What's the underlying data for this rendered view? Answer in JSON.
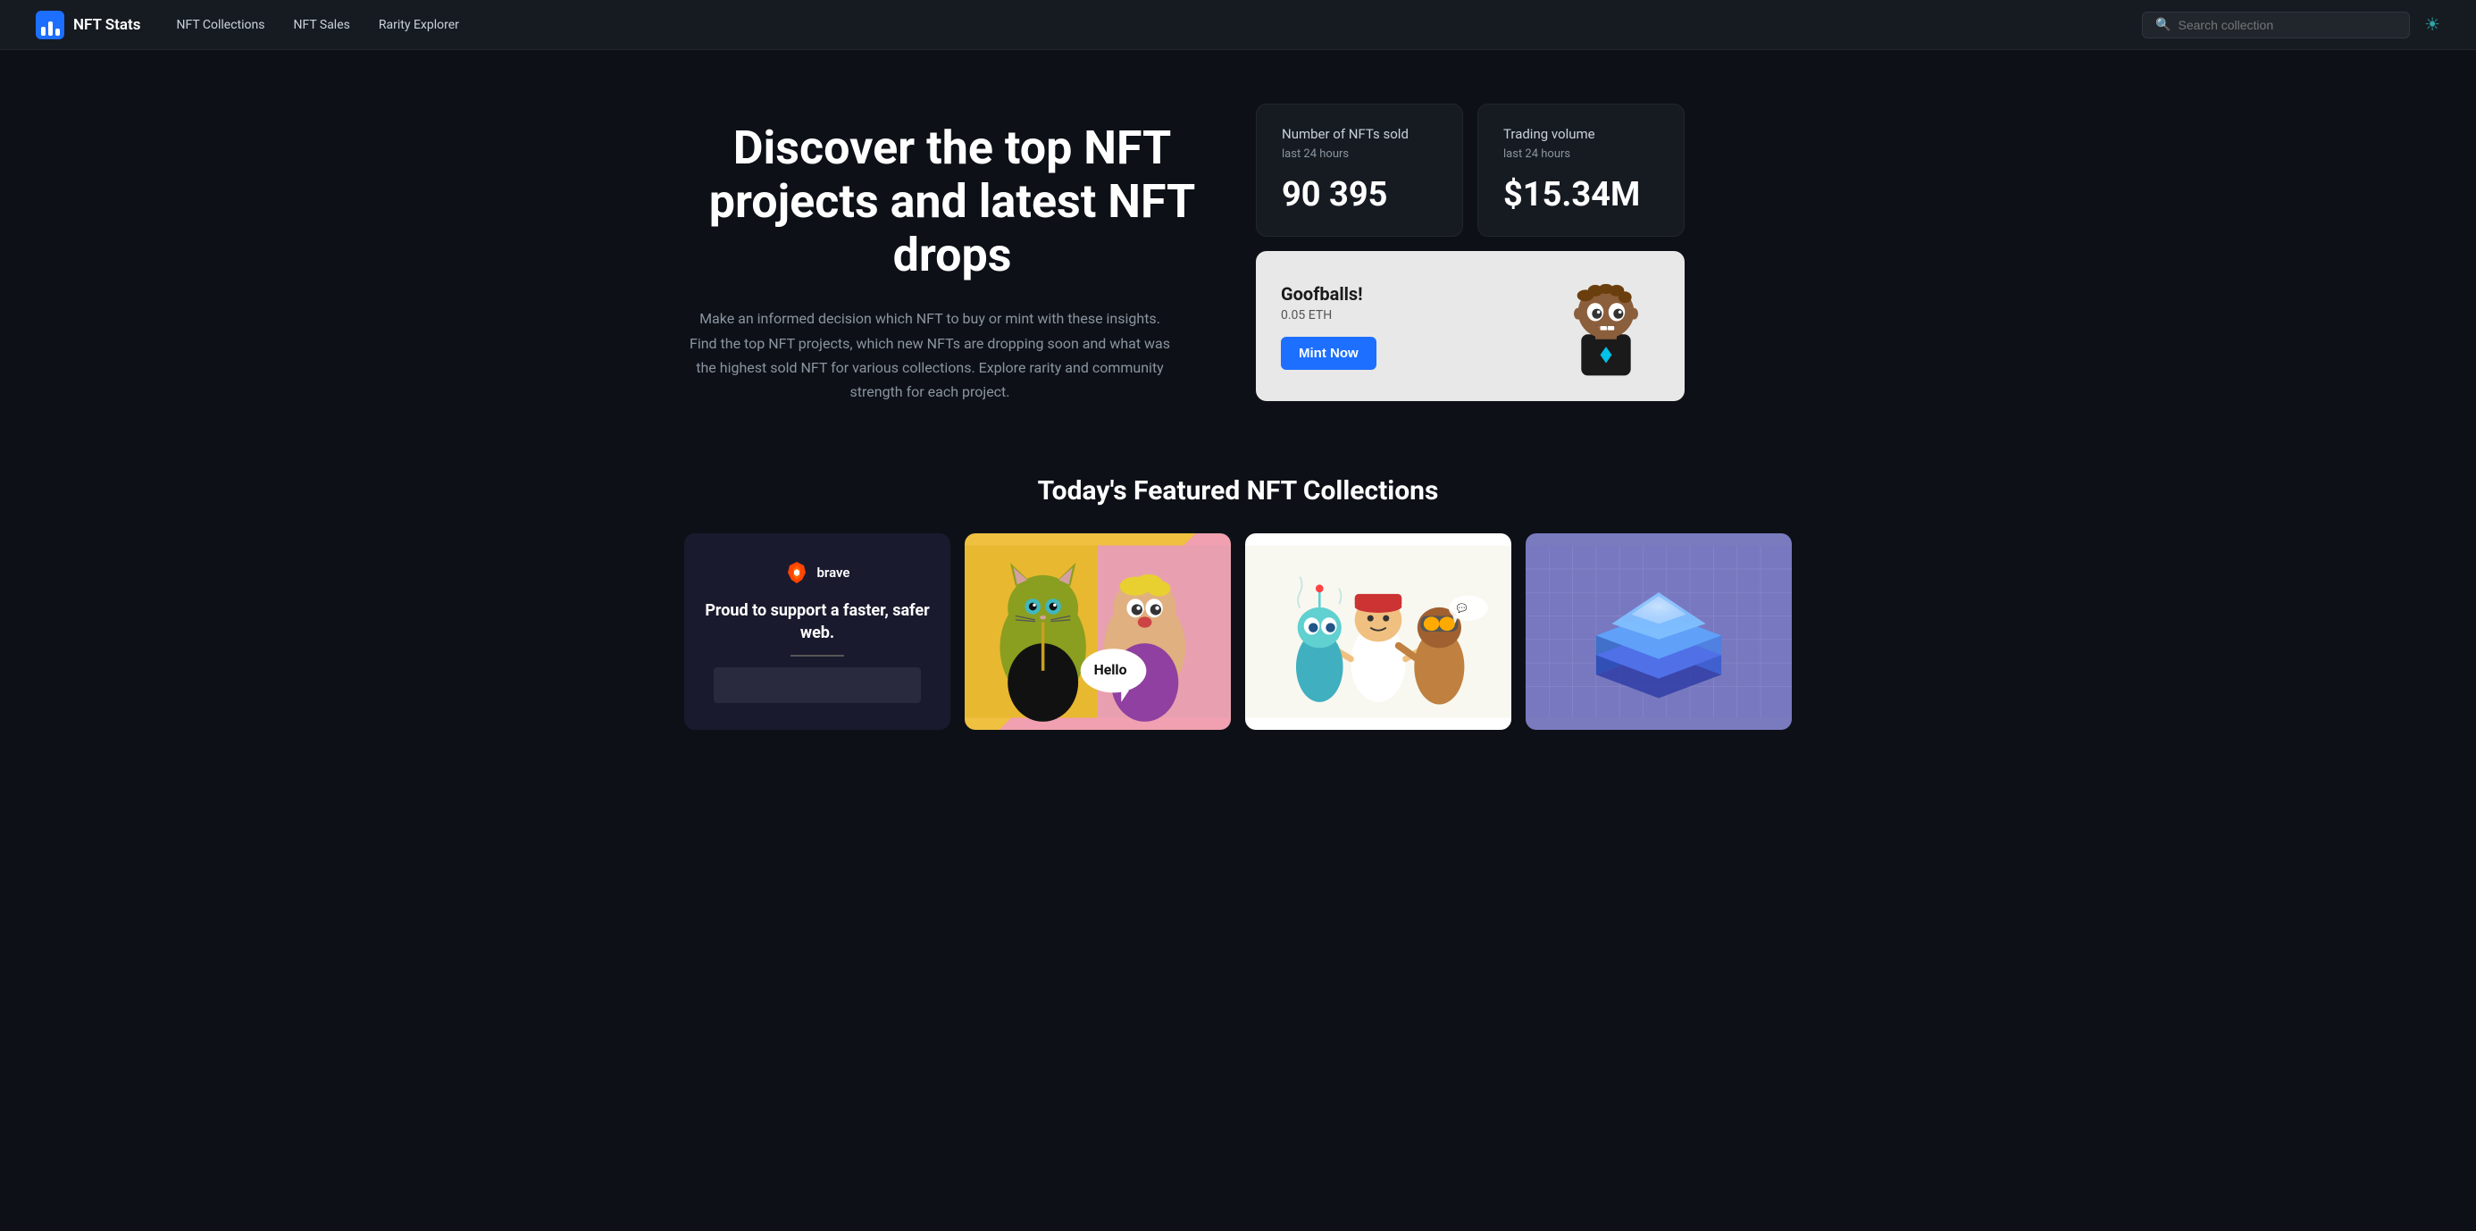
{
  "navbar": {
    "brand_name": "NFT Stats",
    "nav_links": [
      {
        "label": "NFT Collections",
        "id": "nft-collections"
      },
      {
        "label": "NFT Sales",
        "id": "nft-sales"
      },
      {
        "label": "Rarity Explorer",
        "id": "rarity-explorer"
      }
    ],
    "search_placeholder": "Search collection",
    "theme_icon": "☀"
  },
  "hero": {
    "title": "Discover the top NFT projects and latest NFT drops",
    "description": "Make an informed decision which NFT to buy or mint with these insights. Find the top NFT projects, which new NFTs are dropping soon and what was the highest sold NFT for various collections. Explore rarity and community strength for each project."
  },
  "stats": {
    "nfts_sold": {
      "label": "Number of NFTs sold",
      "sublabel": "last 24 hours",
      "value": "90 395"
    },
    "trading_volume": {
      "label": "Trading volume",
      "sublabel": "last 24 hours",
      "value": "$15.34M"
    }
  },
  "mint_card": {
    "title": "Goofballs!",
    "price": "0.05 ETH",
    "button_label": "Mint Now"
  },
  "featured": {
    "title": "Today's Featured NFT Collections",
    "cards": [
      {
        "id": "brave-ad",
        "type": "brave",
        "tagline": "Proud to support a faster, safer web.",
        "brand": "brave"
      },
      {
        "id": "cats",
        "type": "cats"
      },
      {
        "id": "colorful-chars",
        "type": "chars"
      },
      {
        "id": "geometric",
        "type": "geo"
      }
    ]
  }
}
